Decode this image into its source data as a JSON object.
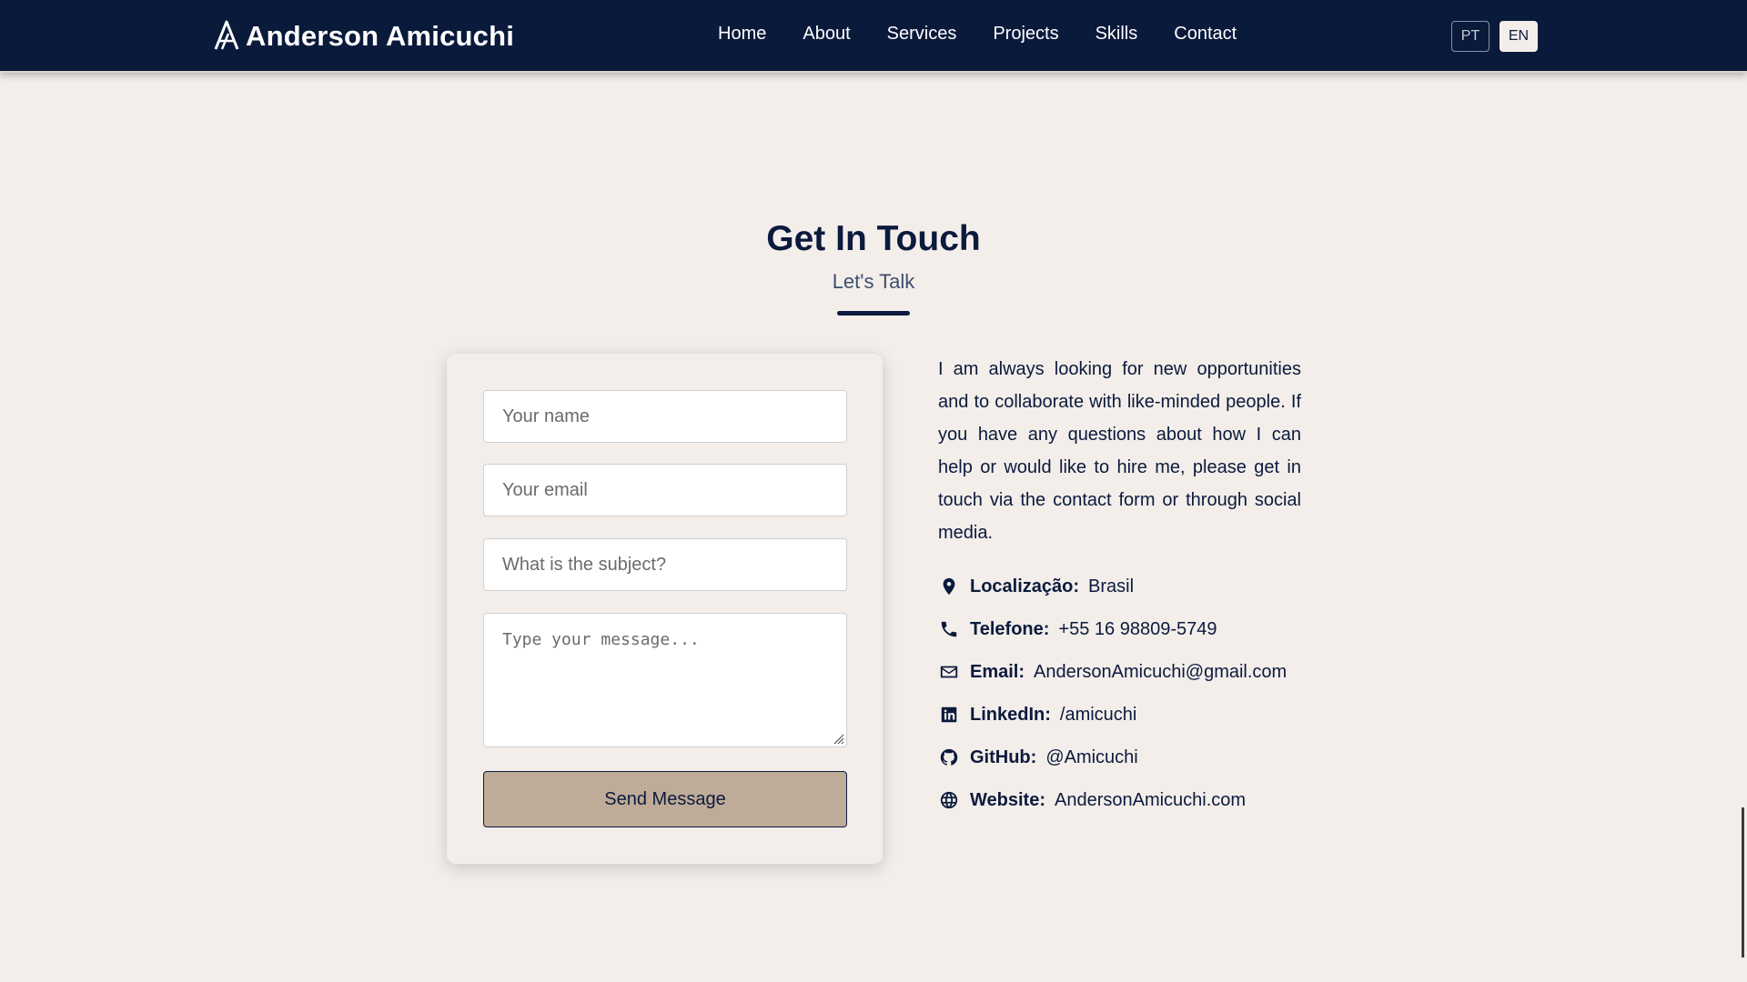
{
  "nav": {
    "brand": "Anderson Amicuchi",
    "links": [
      "Home",
      "About",
      "Services",
      "Projects",
      "Skills",
      "Contact"
    ],
    "lang": {
      "pt": "PT",
      "en": "EN",
      "active": "EN"
    }
  },
  "section": {
    "title": "Get In Touch",
    "subtitle": "Let's Talk"
  },
  "form": {
    "name_placeholder": "Your name",
    "email_placeholder": "Your email",
    "subject_placeholder": "What is the subject?",
    "message_placeholder": "Type your message...",
    "name_value": "",
    "email_value": "",
    "subject_value": "",
    "message_value": "",
    "submit_label": "Send Message"
  },
  "info": {
    "intro": "I am always looking for new opportunities and to collaborate with like-minded people. If you have any questions about how I can help or would like to hire me, please get in touch via the contact form or through social media.",
    "items": [
      {
        "icon": "location-pin-icon",
        "label": "Localização:",
        "value": "Brasil"
      },
      {
        "icon": "phone-icon",
        "label": "Telefone:",
        "value": "+55 16 98809-5749"
      },
      {
        "icon": "envelope-icon",
        "label": "Email:",
        "value": "AndersonAmicuchi@gmail.com"
      },
      {
        "icon": "linkedin-icon",
        "label": "LinkedIn:",
        "value": "/amicuchi"
      },
      {
        "icon": "github-icon",
        "label": "GitHub:",
        "value": "@Amicuchi"
      },
      {
        "icon": "globe-icon",
        "label": "Website:",
        "value": "AndersonAmicuchi.com"
      }
    ]
  },
  "colors": {
    "navbar": "#0a1a3b",
    "page_background": "#f3eeea",
    "accent_button": "#bfac98",
    "text_dark": "#0b1a3d"
  }
}
